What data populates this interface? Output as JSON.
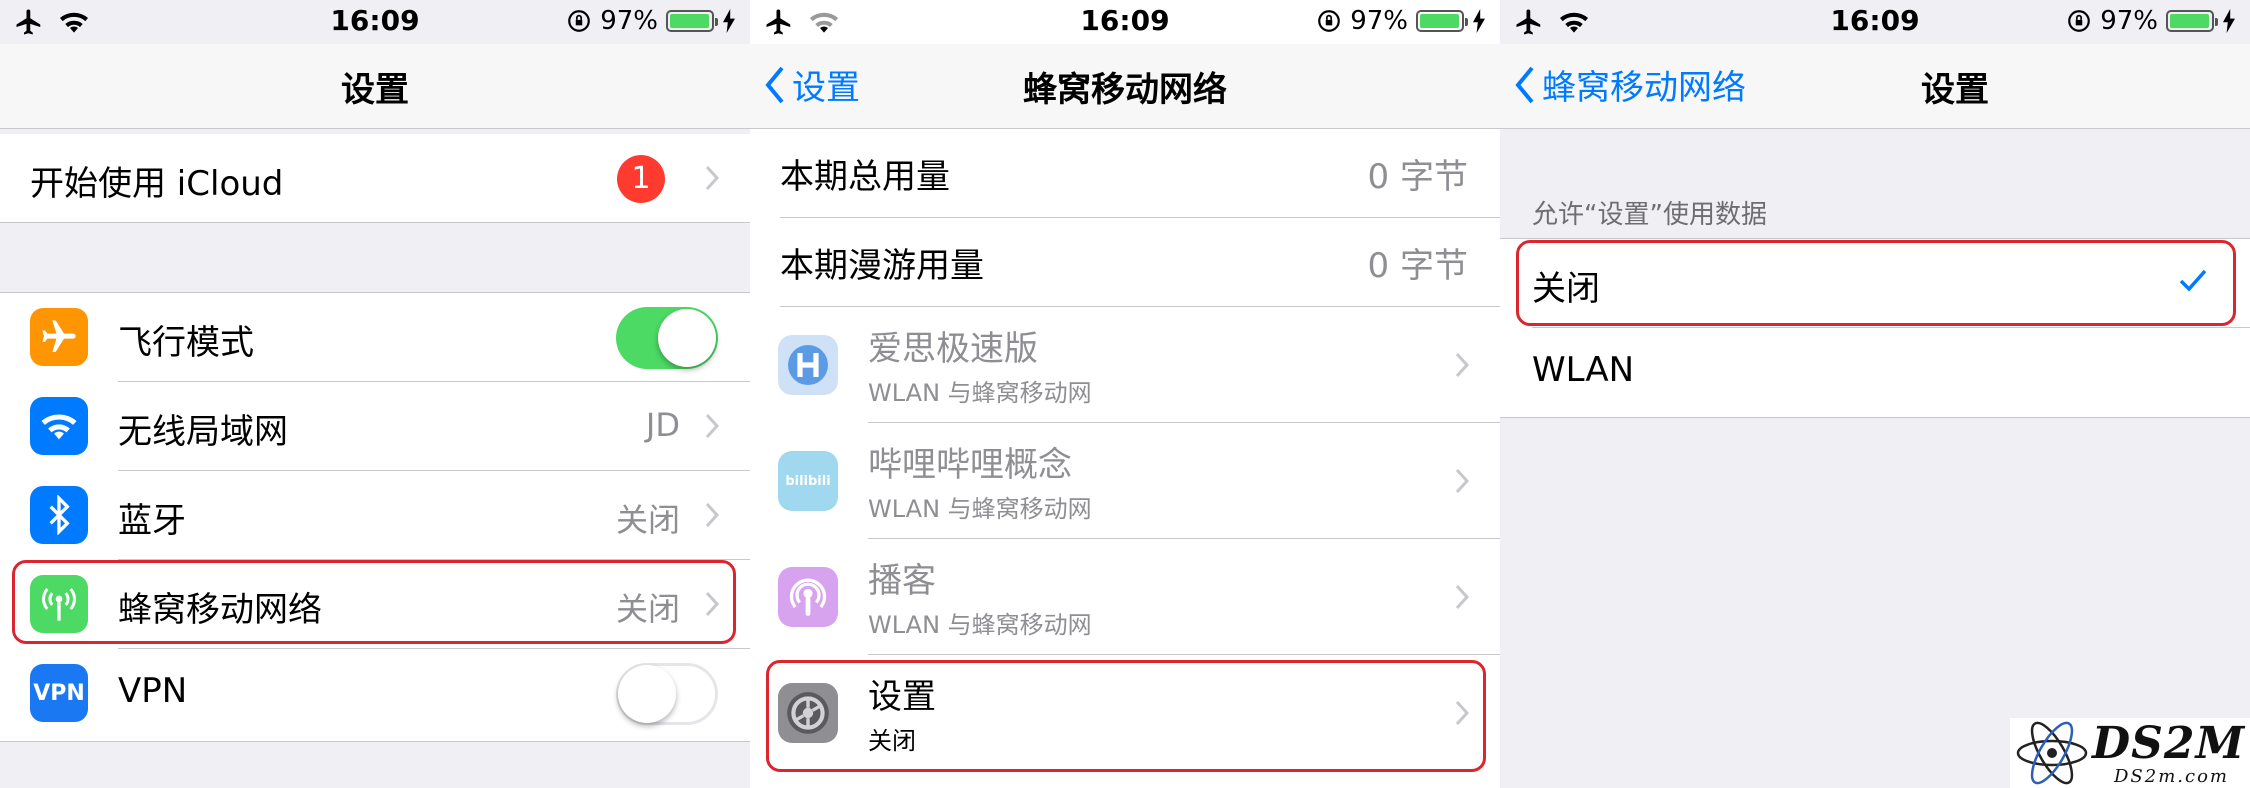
{
  "status": {
    "time": "16:09",
    "battery": "97%"
  },
  "screens": [
    {
      "title": "设置",
      "icloud": {
        "label": "开始使用 iCloud",
        "badge": "1"
      },
      "items": [
        {
          "label": "飞行模式",
          "icon": "airplane-icon",
          "color": "#ff9500",
          "toggle": "on"
        },
        {
          "label": "无线局域网",
          "icon": "wifi-icon",
          "color": "#007aff",
          "value": "JD"
        },
        {
          "label": "蓝牙",
          "icon": "bluetooth-icon",
          "color": "#007aff",
          "value": "关闭"
        },
        {
          "label": "蜂窝移动网络",
          "icon": "cellular-antenna-icon",
          "color": "#4cd964",
          "value": "关闭"
        },
        {
          "label": "VPN",
          "icon": "vpn-icon",
          "icon_text": "VPN",
          "color": "#1a79f2",
          "toggle": "off"
        }
      ]
    },
    {
      "back": "设置",
      "title": "蜂窝移动网络",
      "usage": [
        {
          "label": "本期总用量",
          "value": "0 字节"
        },
        {
          "label": "本期漫游用量",
          "value": "0 字节"
        }
      ],
      "apps": [
        {
          "name": "爱思极速版",
          "sub": "WLAN 与蜂窝移动网",
          "icon": "i4-app-icon"
        },
        {
          "name": "哔哩哔哩概念",
          "sub": "WLAN 与蜂窝移动网",
          "icon": "bilibili-icon",
          "icon_text": "bilibili"
        },
        {
          "name": "播客",
          "sub": "WLAN 与蜂窝移动网",
          "icon": "podcasts-icon"
        },
        {
          "name": "设置",
          "sub": "关闭",
          "icon": "settings-gear-icon"
        }
      ]
    },
    {
      "back": "蜂窝移动网络",
      "title": "设置",
      "section_header": "允许“设置”使用数据",
      "options": [
        {
          "label": "关闭",
          "selected": true
        },
        {
          "label": "WLAN",
          "selected": false
        }
      ]
    }
  ],
  "watermark": {
    "text": "DS2M",
    "sub": "DS2m.com"
  }
}
